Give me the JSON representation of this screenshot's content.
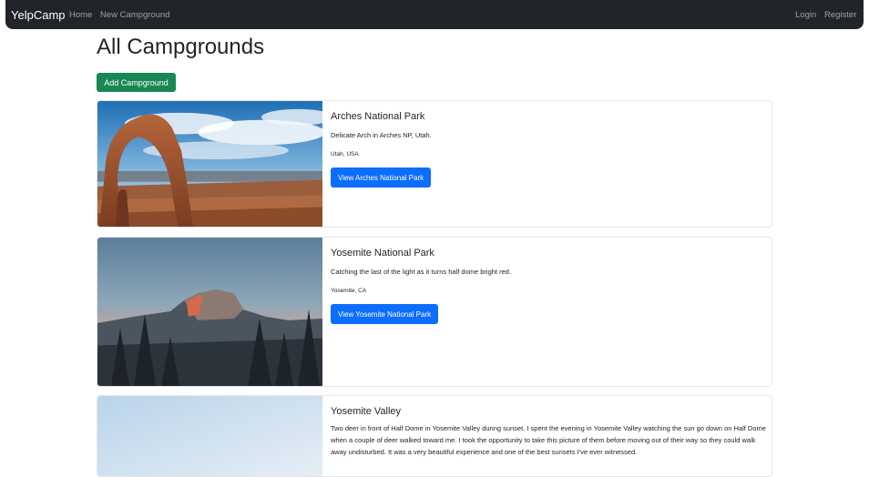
{
  "navbar": {
    "brand": "YelpCamp",
    "links": [
      "Home",
      "New Campground"
    ],
    "auth_links": [
      "Login",
      "Register"
    ]
  },
  "page": {
    "title": "All Campgrounds",
    "add_button": "Add Campground"
  },
  "campgrounds": [
    {
      "title": "Arches National Park",
      "description": "Delicate Arch in Arches NP, Utah.",
      "location": "Utah, USA",
      "button": "View Arches National Park"
    },
    {
      "title": "Yosemite National Park",
      "description": "Catching the last of the light as it turns half dome bright red.",
      "location": "Yosemite, CA",
      "button": "View Yosemite National Park"
    },
    {
      "title": "Yosemite Valley",
      "description": "Two deer in front of Half Dome in Yosemite Valley during sunset. I spent the evening in Yosemite Valley watching the sun go down on Half Dome when a couple of deer walked toward me. I took the opportunity to take this picture of them before moving out of their way so they could walk away undisturbed. It was a very beautiful experience and one of the best sunsets I've ever witnessed."
    }
  ],
  "colors": {
    "navbar_bg": "#212529",
    "success": "#198754",
    "primary": "#0d6efd"
  }
}
